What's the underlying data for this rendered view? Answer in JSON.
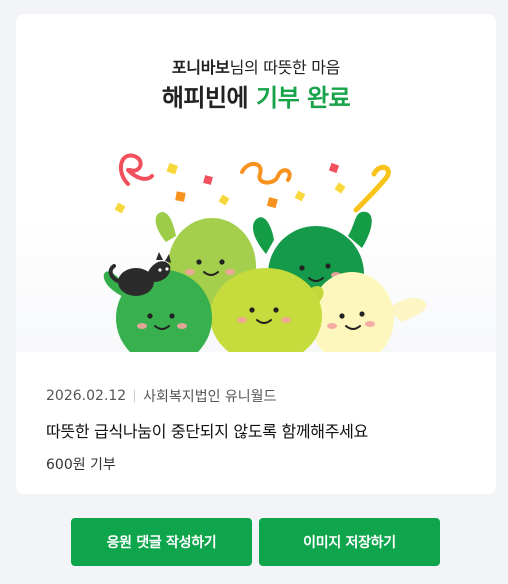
{
  "hero": {
    "donor_name": "포니바보",
    "donor_suffix": "님의 따뜻한 마음",
    "title_prefix": "해피빈에 ",
    "title_highlight": "기부 완료"
  },
  "donation": {
    "date": "2026.02.12",
    "organization": "사회복지법인 유니월드",
    "campaign_title": "따뜻한 급식나눔이 중단되지 않도록 함께해주세요",
    "amount": "600원 기부"
  },
  "actions": {
    "comment_label": "응원 댓글 작성하기",
    "save_label": "이미지 저장하기"
  },
  "colors": {
    "accent": "#16a34a",
    "button": "#0fa54d",
    "background": "#f2f4f7"
  }
}
